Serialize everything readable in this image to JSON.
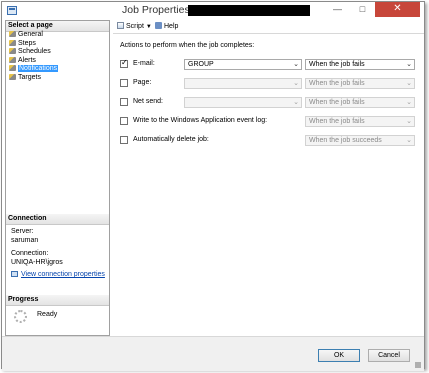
{
  "window": {
    "title": "Job Properties - "
  },
  "left_pane": {
    "select_page_header": "Select a page",
    "pages": [
      {
        "label": "General",
        "selected": false
      },
      {
        "label": "Steps",
        "selected": false
      },
      {
        "label": "Schedules",
        "selected": false
      },
      {
        "label": "Alerts",
        "selected": false
      },
      {
        "label": "Notifications",
        "selected": true
      },
      {
        "label": "Targets",
        "selected": false
      }
    ],
    "connection_header": "Connection",
    "server_label": "Server:",
    "server_value": "saruman",
    "connection_label": "Connection:",
    "connection_value": "UNIQA-HR\\jgros",
    "view_connection_link": "View connection properties",
    "progress_header": "Progress",
    "progress_status": "Ready"
  },
  "toolbar": {
    "script_label": "Script",
    "help_label": "Help"
  },
  "content": {
    "heading": "Actions to perform when the job completes:",
    "rows": [
      {
        "label": "E-mail:",
        "checked": true,
        "operator": "GROUP",
        "operator_enabled": true,
        "condition": "When the job fails",
        "condition_enabled": true
      },
      {
        "label": "Page:",
        "checked": false,
        "operator": "",
        "operator_enabled": false,
        "condition": "When the job fails",
        "condition_enabled": false
      },
      {
        "label": "Net send:",
        "checked": false,
        "operator": "",
        "operator_enabled": false,
        "condition": "When the job fails",
        "condition_enabled": false
      },
      {
        "label": "Write to the Windows Application event log:",
        "checked": false,
        "condition": "When the job fails",
        "condition_enabled": false
      },
      {
        "label": "Automatically delete job:",
        "checked": false,
        "condition": "When the job succeeds",
        "condition_enabled": false
      }
    ]
  },
  "footer": {
    "ok_label": "OK",
    "cancel_label": "Cancel"
  },
  "colors": {
    "selection": "#3399ff",
    "close_button": "#c7463a",
    "link": "#0645ad"
  }
}
